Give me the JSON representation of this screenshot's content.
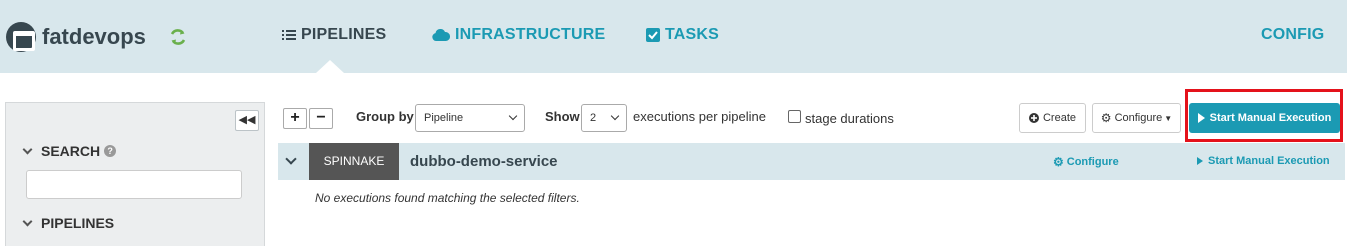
{
  "header": {
    "app_name": "fatdevops",
    "nav": {
      "pipelines": "PIPELINES",
      "infrastructure": "INFRASTRUCTURE",
      "tasks": "TASKS",
      "config": "CONFIG"
    },
    "colors": {
      "bar": "#d8e7ec",
      "accent": "#1b9ab3",
      "dark": "#37474f",
      "refresh": "#6ab04c"
    },
    "icons": [
      "app-logo-icon",
      "refresh-icon",
      "list-icon",
      "cloud-icon",
      "checkbox-icon"
    ]
  },
  "sidebar": {
    "search_heading": "SEARCH",
    "search_value": "",
    "pipelines_heading": "PIPELINES",
    "collapse_label": "◀◀"
  },
  "toolbar": {
    "expand_label": "+",
    "collapse_label": "−",
    "group_by_label": "Group by",
    "group_by_value": "Pipeline",
    "show_label": "Show",
    "show_value": "2",
    "executions_label": "executions per pipeline",
    "stage_durations_label": "stage durations",
    "stage_durations_checked": false,
    "create_label": "Create",
    "configure_label": "Configure",
    "start_label": "Start Manual Execution",
    "highlight_color": "#e4121b"
  },
  "group": {
    "application_tag": "SPINNAKE",
    "pipeline_name": "dubbo-demo-service",
    "configure_label": "Configure",
    "start_label": "Start Manual Execution",
    "empty_message": "No executions found matching the selected filters."
  }
}
